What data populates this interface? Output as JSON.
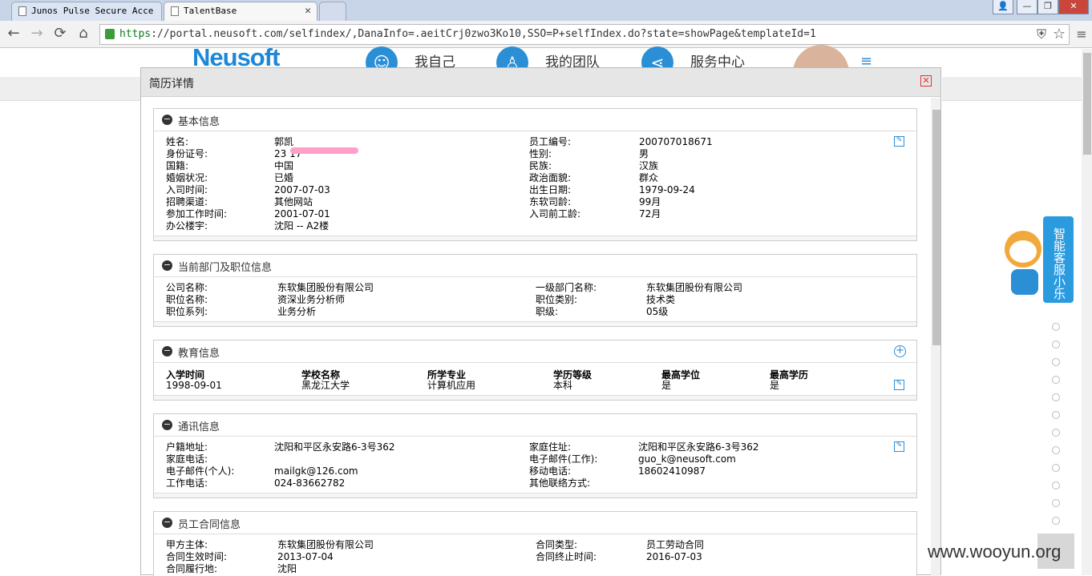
{
  "browser": {
    "tabs": [
      {
        "title": "Junos Pulse Secure Acce"
      },
      {
        "title": "TalentBase"
      }
    ],
    "url": {
      "scheme": "https",
      "rest": "://portal.neusoft.com/selfindex/,DanaInfo=.aeitCrj0zwo3Ko10,SSO=P+selfIndex.do?state=showPage&templateId=1"
    },
    "window_buttons": [
      "👤",
      "—",
      "❐",
      "✕"
    ],
    "nav_glyphs": {
      "back": "←",
      "forward": "→",
      "reload": "⟳",
      "home": "⌂",
      "star": "☆",
      "shield": "⛨"
    }
  },
  "site": {
    "logo": "Neusoft",
    "nav": [
      {
        "label": "我自己",
        "icon": "user-icon"
      },
      {
        "label": "我的团队",
        "icon": "team-icon"
      },
      {
        "label": "服务中心",
        "icon": "share-icon"
      }
    ],
    "menu_glyph": "≡"
  },
  "modal": {
    "title": "简历详情",
    "close_glyph": "✕",
    "sections": {
      "basic": {
        "title": "基本信息",
        "left": [
          {
            "label": "姓名:",
            "value": "郭凯"
          },
          {
            "label": "身份证号:",
            "value": "23              17"
          },
          {
            "label": "国籍:",
            "value": "中国"
          },
          {
            "label": "婚姻状况:",
            "value": "已婚"
          },
          {
            "label": "入司时间:",
            "value": "2007-07-03"
          },
          {
            "label": "招聘渠道:",
            "value": "其他网站"
          },
          {
            "label": "参加工作时间:",
            "value": "2001-07-01"
          },
          {
            "label": "办公楼宇:",
            "value": "沈阳 -- A2楼"
          }
        ],
        "right": [
          {
            "label": "员工编号:",
            "value": "200707018671"
          },
          {
            "label": "性别:",
            "value": "男"
          },
          {
            "label": "民族:",
            "value": "汉族"
          },
          {
            "label": "政治面貌:",
            "value": "群众"
          },
          {
            "label": "出生日期:",
            "value": "1979-09-24"
          },
          {
            "label": "东软司龄:",
            "value": "99月"
          },
          {
            "label": "入司前工龄:",
            "value": "72月"
          }
        ]
      },
      "dept": {
        "title": "当前部门及职位信息",
        "left": [
          {
            "label": "公司名称:",
            "value": "东软集团股份有限公司"
          },
          {
            "label": "职位名称:",
            "value": "资深业务分析师"
          },
          {
            "label": "职位系列:",
            "value": "业务分析"
          }
        ],
        "right": [
          {
            "label": "一级部门名称:",
            "value": "东软集团股份有限公司"
          },
          {
            "label": "职位类别:",
            "value": "技术类"
          },
          {
            "label": "职级:",
            "value": "05级"
          }
        ]
      },
      "education": {
        "title": "教育信息",
        "plus_glyph": "+",
        "headers": [
          "入学时间",
          "学校名称",
          "所学专业",
          "学历等级",
          "最高学位",
          "最高学历"
        ],
        "rows": [
          [
            "1998-09-01",
            "黑龙江大学",
            "计算机应用",
            "本科",
            "是",
            "是"
          ]
        ]
      },
      "contact": {
        "title": "通讯信息",
        "left": [
          {
            "label": "户籍地址:",
            "value": "沈阳和平区永安路6-3号362"
          },
          {
            "label": "家庭电话:",
            "value": ""
          },
          {
            "label": "电子邮件(个人):",
            "value": "mailgk@126.com"
          },
          {
            "label": "工作电话:",
            "value": "024-83662782"
          }
        ],
        "right": [
          {
            "label": "家庭住址:",
            "value": "沈阳和平区永安路6-3号362"
          },
          {
            "label": "电子邮件(工作):",
            "value": "guo_k@neusoft.com"
          },
          {
            "label": "移动电话:",
            "value": "18602410987"
          },
          {
            "label": "其他联络方式:",
            "value": ""
          }
        ]
      },
      "contract": {
        "title": "员工合同信息",
        "left": [
          {
            "label": "甲方主体:",
            "value": "东软集团股份有限公司"
          },
          {
            "label": "合同生效时间:",
            "value": "2013-07-04"
          },
          {
            "label": "合同履行地:",
            "value": "沈阳"
          }
        ],
        "right": [
          {
            "label": "合同类型:",
            "value": "员工劳动合同"
          },
          {
            "label": "合同终止时间:",
            "value": "2016-07-03"
          }
        ]
      }
    },
    "edit_glyph": "✎",
    "minus_glyph": "−"
  },
  "widgets": {
    "help_label": "智能客服小乐",
    "watermark": "www.wooyun.org"
  }
}
